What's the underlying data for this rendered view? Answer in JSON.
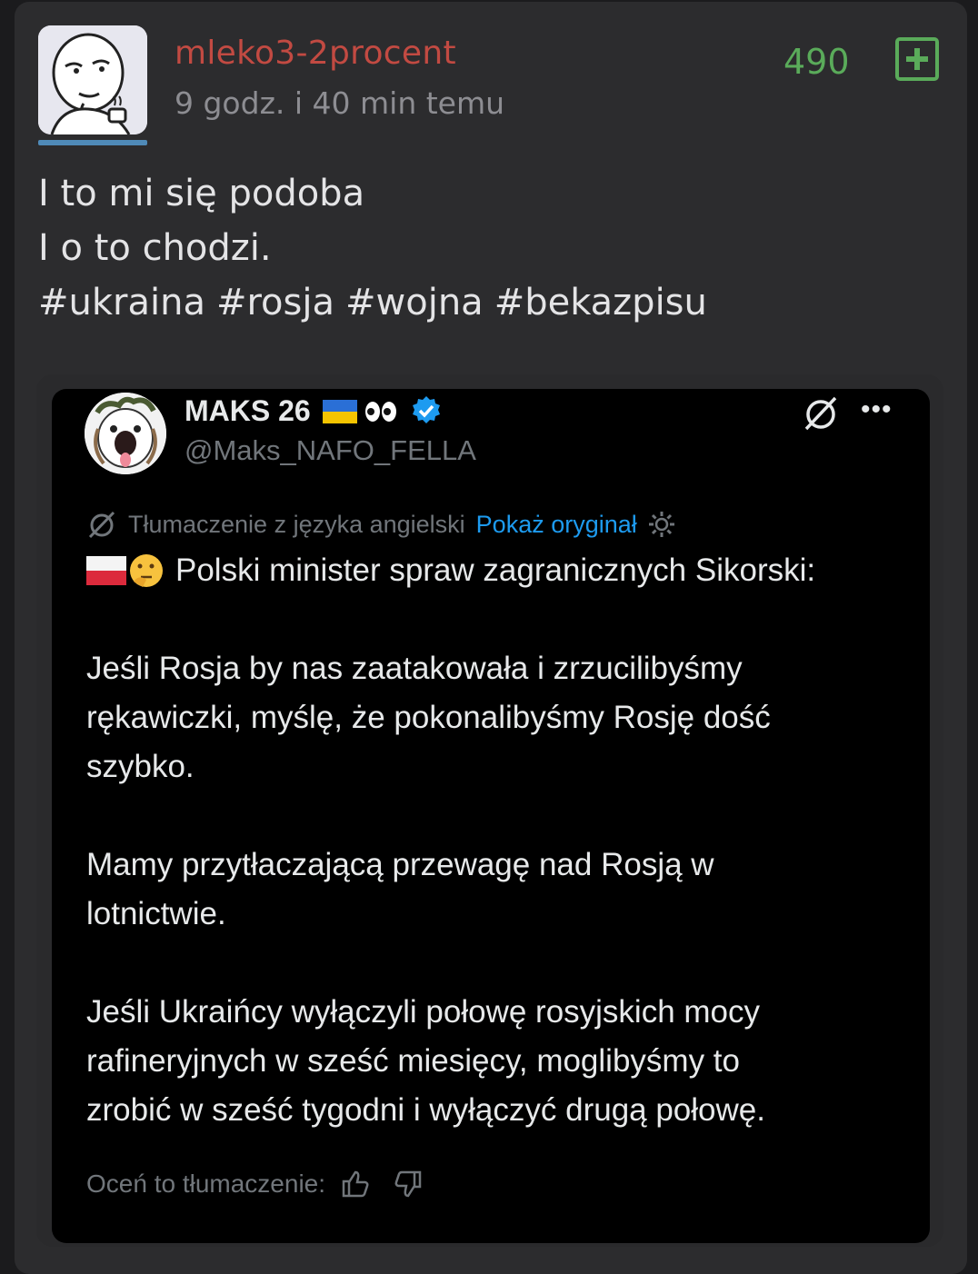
{
  "post": {
    "username": "mleko3-2procent",
    "time": "9 godz. i 40 min temu",
    "score": "490",
    "lines": [
      "I to mi się podoba",
      "I o to chodzi."
    ],
    "tags": [
      "#ukraina",
      "#rosja",
      "#wojna",
      "#bekazpisu"
    ]
  },
  "tweet": {
    "name": "MAKS 26",
    "handle": "@Maks_NAFO_FELLA",
    "translation_label": "Tłumaczenie z języka angielski",
    "show_original": "Pokaż oryginał",
    "lines": [
      "Polski minister spraw zagranicznych Sikorski:",
      "Jeśli Rosja by nas zaatakowała i zrzucilibyśmy",
      "rękawiczki, myślę, że pokonalibyśmy Rosję dość",
      "szybko.",
      "Mamy przytłaczającą przewagę nad Rosją w",
      "lotnictwie.",
      "Jeśli Ukraińcy wyłączyli połowę rosyjskich mocy",
      "rafineryjnych w sześć miesięcy, moglibyśmy to",
      "zrobić w sześć tygodni i wyłączyć drugą połowę."
    ],
    "rate_label": "Oceń to tłumaczenie:"
  },
  "colors": {
    "username": "#c24a42",
    "score": "#5aab5a",
    "link": "#1d9bf0",
    "verified": "#1d9bf0"
  }
}
